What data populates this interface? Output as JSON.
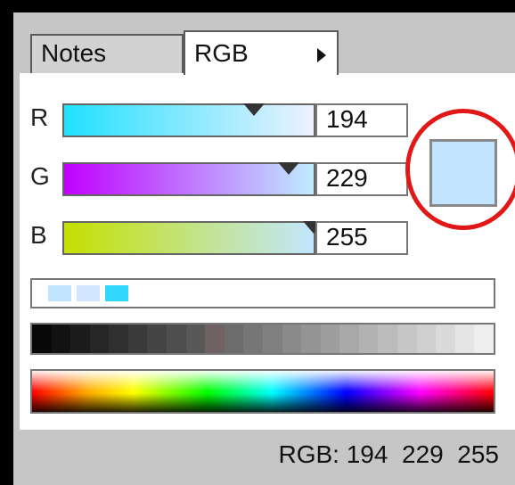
{
  "tabs": [
    {
      "label": "Notes",
      "active": false
    },
    {
      "label": "RGB",
      "active": true
    }
  ],
  "channels": [
    {
      "label": "R",
      "value": "194",
      "gradient_from": "#22e0ff",
      "gradient_to": "#eef2ff",
      "level": 0.76
    },
    {
      "label": "G",
      "value": "229",
      "gradient_from": "#c000ff",
      "gradient_to": "#c0ecff",
      "level": 0.9
    },
    {
      "label": "B",
      "value": "255",
      "gradient_from": "#c4e000",
      "gradient_to": "#c2e6ff",
      "level": 1.0
    }
  ],
  "current_color": "#c2e5ff",
  "recent_colors": [
    "#c2e5ff",
    "#d2e6ff",
    "#33d8ff"
  ],
  "status_text": "RGB: 194  229  255"
}
